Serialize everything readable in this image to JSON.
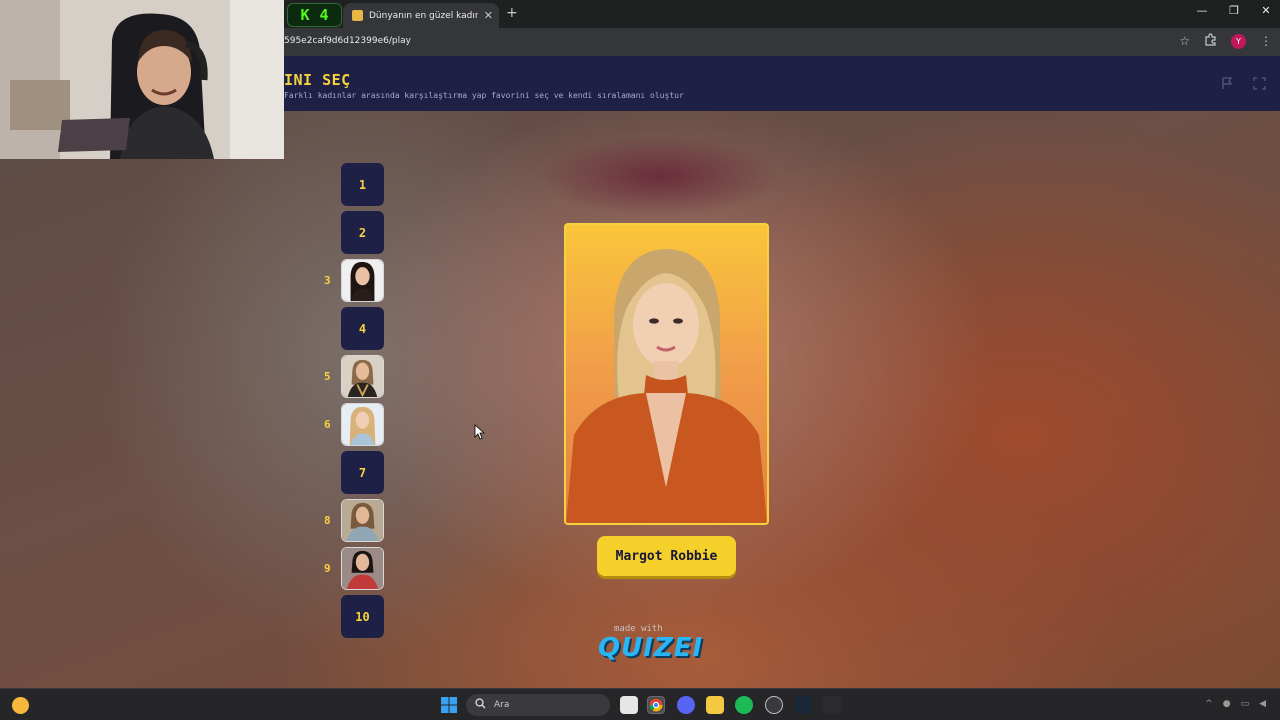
{
  "browser": {
    "kick_label": "4",
    "tab_title": "Dünyanın en güzel kadınını seç",
    "tab_close": "✕",
    "new_tab": "+",
    "url": "595e2caf9d6d12399e6/play",
    "profile_initial": "Y",
    "window_buttons": [
      "—",
      "❐",
      "✕"
    ]
  },
  "quiz": {
    "title": "INI SEÇ",
    "subtitle": "Farklı kadınlar arasında karşılaştırma yap favorini seç ve kendi sıralamanı oluştur",
    "ranking": [
      {
        "rank": "1",
        "filled": false
      },
      {
        "rank": "2",
        "filled": false
      },
      {
        "rank": "3",
        "filled": true
      },
      {
        "rank": "4",
        "filled": false
      },
      {
        "rank": "5",
        "filled": true
      },
      {
        "rank": "6",
        "filled": true
      },
      {
        "rank": "7",
        "filled": false
      },
      {
        "rank": "8",
        "filled": true
      },
      {
        "rank": "9",
        "filled": true
      },
      {
        "rank": "10",
        "filled": false
      }
    ],
    "candidate_name": "Margot Robbie",
    "made_with": "made with",
    "brand": "QUIZEI"
  },
  "taskbar": {
    "search_placeholder": "Ara"
  },
  "colors": {
    "accent_yellow": "#f7d23e",
    "header_navy": "#1e2145",
    "brand_blue": "#29b6f6",
    "kick_green": "#53fc18"
  },
  "icons": [
    "star-icon",
    "extensions-icon",
    "menu-icon",
    "flag-icon",
    "fullscreen-icon",
    "search-icon",
    "windows-start-icon"
  ]
}
